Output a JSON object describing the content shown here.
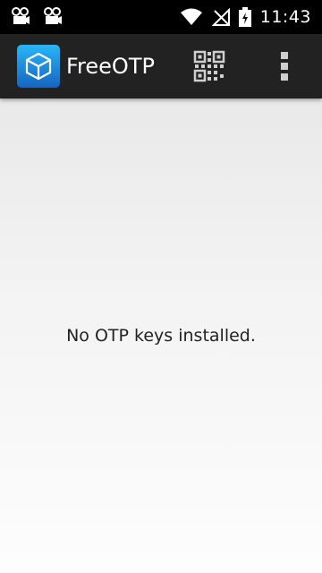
{
  "status_bar": {
    "time": "11:43",
    "icons": [
      "notification-icon",
      "notification-icon",
      "wifi-icon",
      "no-signal-icon",
      "battery-icon"
    ]
  },
  "app_bar": {
    "title": "FreeOTP",
    "icons": [
      "app-logo-icon",
      "qr-code-icon",
      "overflow-menu-icon"
    ]
  },
  "main": {
    "empty_message": "No OTP keys installed."
  },
  "colors": {
    "status_bar": "#000000",
    "app_bar": "#222222",
    "app_icon": "#1e90ff",
    "background": "#f3f3f3"
  }
}
